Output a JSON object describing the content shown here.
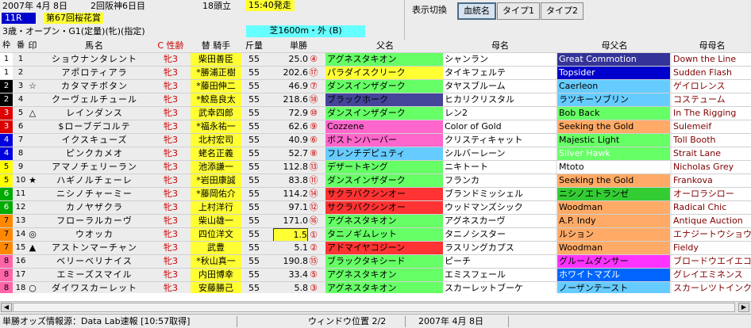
{
  "header": {
    "date": "2007年 4月 8日",
    "kaisai": "2回阪神6日目",
    "headcount": "18頭立",
    "start_time": "15:40発走",
    "race_no": "11R",
    "race_name": "第67回桜花賞",
    "conditions": "3歳・オープン・G1(定量)(牝)(指定)",
    "distance": "芝1600m・外 (B)",
    "display_label": "表示切換",
    "tabs": [
      "血統名",
      "タイプ1",
      "タイプ2"
    ]
  },
  "columns": {
    "frame": "枠",
    "num": "番",
    "mark": "印",
    "horse": "馬名",
    "sex": "C 性齢",
    "jockey": "替 騎手",
    "weight": "斤量",
    "odds": "単勝",
    "sire": "父名",
    "dam": "母名",
    "bms": "母父名",
    "mgs": "母母名"
  },
  "frame_colors": {
    "1": [
      "#ffffff",
      "#000000"
    ],
    "2": [
      "#000000",
      "#ffffff"
    ],
    "3": [
      "#dd0000",
      "#ffffff"
    ],
    "4": [
      "#0000dd",
      "#ffffff"
    ],
    "5": [
      "#ffff00",
      "#000000"
    ],
    "6": [
      "#00aa00",
      "#ffffff"
    ],
    "7": [
      "#ff8800",
      "#000000"
    ],
    "8": [
      "#ff66aa",
      "#000000"
    ]
  },
  "rows": [
    {
      "frame": "1",
      "num": "1",
      "mark": "",
      "horse": "ショウナンタレント",
      "sex": "牝3",
      "jockey": "柴田善臣",
      "weight": "55",
      "odds": "25.0",
      "pop": "④",
      "sire": "アグネスタキオン",
      "sire_bg": "#66ff66",
      "dam": "シャンラン",
      "bms": "Great Commotion",
      "bms_bg": "#333399",
      "bms_fg": "#ffffff",
      "mgs": "Down the Line"
    },
    {
      "frame": "1",
      "num": "2",
      "mark": "",
      "horse": "アポロティアラ",
      "sex": "牝3",
      "jockey": "*勝浦正樹",
      "weight": "55",
      "odds": "202.6",
      "pop": "⑰",
      "sire": "パラダイスクリーク",
      "sire_bg": "#ffff33",
      "dam": "タイキフェルテ",
      "bms": "Topsider",
      "bms_bg": "#0000cc",
      "bms_fg": "#ffffff",
      "mgs": "Sudden Flash"
    },
    {
      "frame": "2",
      "num": "3",
      "mark": "☆",
      "horse": "カタマチボタン",
      "sex": "牝3",
      "jockey": "*藤田伸二",
      "weight": "55",
      "odds": "46.9",
      "pop": "⑦",
      "sire": "ダンスインザダーク",
      "sire_bg": "#66ff66",
      "dam": "タヤスブルーム",
      "bms": "Caerleon",
      "bms_bg": "#66ccff",
      "bms_fg": "#000000",
      "mgs": "ゲイロレンス"
    },
    {
      "frame": "2",
      "num": "4",
      "mark": "",
      "horse": "クーヴェルチュール",
      "sex": "牝3",
      "jockey": "*鮫島良太",
      "weight": "55",
      "odds": "218.6",
      "pop": "⑱",
      "sire": "ブラックホーク",
      "sire_bg": "#444499",
      "dam": "ヒカリクリスタル",
      "bms": "ラツキーソブリン",
      "bms_bg": "#66ccff",
      "bms_fg": "#000000",
      "mgs": "コステューム"
    },
    {
      "frame": "3",
      "num": "5",
      "mark": "△",
      "horse": "レインダンス",
      "sex": "牝3",
      "jockey": "武幸四郎",
      "weight": "55",
      "odds": "72.9",
      "pop": "⑩",
      "sire": "ダンスインザダーク",
      "sire_bg": "#66ff66",
      "dam": "レン2",
      "bms": "Bob Back",
      "bms_bg": "#66ff66",
      "bms_fg": "#000000",
      "mgs": "In The Rigging"
    },
    {
      "frame": "3",
      "num": "6",
      "mark": "",
      "horse": "$ローブデコルテ",
      "sex": "牝3",
      "jockey": "*福永祐一",
      "weight": "55",
      "odds": "62.6",
      "pop": "⑨",
      "sire": "Cozzene",
      "sire_bg": "#ff66cc",
      "dam": "Color of Gold",
      "bms": "Seeking the Gold",
      "bms_bg": "#ffaa66",
      "bms_fg": "#000000",
      "mgs": "Sulemeif"
    },
    {
      "frame": "4",
      "num": "7",
      "mark": "",
      "horse": "イクスキューズ",
      "sex": "牝3",
      "jockey": "北村宏司",
      "weight": "55",
      "odds": "40.9",
      "pop": "⑥",
      "sire": "ボストンハーバー",
      "sire_bg": "#ff66cc",
      "dam": "クリスティキャット",
      "bms": "Majestic Light",
      "bms_bg": "#66ff66",
      "bms_fg": "#000000",
      "mgs": "Toll Booth"
    },
    {
      "frame": "4",
      "num": "8",
      "mark": "",
      "horse": "ピンクカメオ",
      "sex": "牝3",
      "jockey": "蛯名正義",
      "weight": "55",
      "odds": "52.7",
      "pop": "⑧",
      "sire": "フレンチデピュティ",
      "sire_bg": "#66ccff",
      "dam": "シルバーレーン",
      "bms": "Silver Hawk",
      "bms_bg": "#66ff66",
      "bms_fg": "#ffffff",
      "mgs": "Strait Lane"
    },
    {
      "frame": "5",
      "num": "9",
      "mark": "",
      "horse": "アマノチェリーラン",
      "sex": "牝3",
      "jockey": "池添謙一",
      "weight": "55",
      "odds": "112.8",
      "pop": "⑬",
      "sire": "デザートキング",
      "sire_bg": "#66ff66",
      "dam": "ニキトート",
      "bms": "Mtoto",
      "bms_bg": "#ffffff",
      "bms_fg": "#000000",
      "mgs": "Nicholas Grey"
    },
    {
      "frame": "5",
      "num": "10",
      "mark": "★",
      "horse": "ハギノルチェーレ",
      "sex": "牝3",
      "jockey": "*岩田康誠",
      "weight": "55",
      "odds": "83.8",
      "pop": "⑪",
      "sire": "ダンスインザダーク",
      "sire_bg": "#66ff66",
      "dam": "フランカ",
      "bms": "Seeking the Gold",
      "bms_bg": "#ffaa66",
      "bms_fg": "#000000",
      "mgs": "Frankova"
    },
    {
      "frame": "6",
      "num": "11",
      "mark": "",
      "horse": "ニシノチャーミー",
      "sex": "牝3",
      "jockey": "*藤岡佑介",
      "weight": "55",
      "odds": "114.2",
      "pop": "⑭",
      "sire": "サクラバクシンオー",
      "sire_bg": "#ff3333",
      "dam": "ブランドミッシェル",
      "bms": "ニシノエトランゼ",
      "bms_bg": "#33cc33",
      "bms_fg": "#000000",
      "mgs": "オーロラシロー"
    },
    {
      "frame": "6",
      "num": "12",
      "mark": "",
      "horse": "カノヤザクラ",
      "sex": "牝3",
      "jockey": "上村洋行",
      "weight": "55",
      "odds": "97.1",
      "pop": "⑫",
      "sire": "サクラバクシンオー",
      "sire_bg": "#ff3333",
      "dam": "ウッドマンズシック",
      "bms": "Woodman",
      "bms_bg": "#ffaa66",
      "bms_fg": "#000000",
      "mgs": "Radical Chic"
    },
    {
      "frame": "7",
      "num": "13",
      "mark": "",
      "horse": "フローラルカーヴ",
      "sex": "牝3",
      "jockey": "柴山雄一",
      "weight": "55",
      "odds": "171.0",
      "pop": "⑯",
      "sire": "アグネスタキオン",
      "sire_bg": "#66ff66",
      "dam": "アグネスカーヴ",
      "bms": "A.P. Indy",
      "bms_bg": "#ffaa66",
      "bms_fg": "#000000",
      "mgs": "Antique Auction"
    },
    {
      "frame": "7",
      "num": "14",
      "mark": "◎",
      "horse": "ウオッカ",
      "sex": "牝3",
      "jockey": "四位洋文",
      "weight": "55",
      "odds": "1.5",
      "pop": "①",
      "odds_hl": true,
      "sire": "タニノギムレット",
      "sire_bg": "#66ff66",
      "dam": "タニノシスター",
      "bms": "ルション",
      "bms_bg": "#ffaa66",
      "bms_fg": "#000000",
      "mgs": "エナジートウショウ"
    },
    {
      "frame": "7",
      "num": "15",
      "mark": "▲",
      "horse": "アストンマーチャン",
      "sex": "牝3",
      "jockey": "武豊",
      "weight": "55",
      "odds": "5.1",
      "pop": "②",
      "sire": "アドマイヤコジーン",
      "sire_bg": "#ff3333",
      "dam": "ラスリングカプス",
      "bms": "Woodman",
      "bms_bg": "#ffaa66",
      "bms_fg": "#000000",
      "mgs": "Fieldy"
    },
    {
      "frame": "8",
      "num": "16",
      "mark": "",
      "horse": "ベリーベリナイス",
      "sex": "牝3",
      "jockey": "*秋山真一",
      "weight": "55",
      "odds": "190.8",
      "pop": "⑮",
      "sire": "ブラックタキシード",
      "sire_bg": "#66ff66",
      "dam": "ピーチ",
      "bms": "グルームダンサー",
      "bms_bg": "#ff33ff",
      "bms_fg": "#000000",
      "mgs": "ブロードウエイエコル"
    },
    {
      "frame": "8",
      "num": "17",
      "mark": "",
      "horse": "エミーズスマイル",
      "sex": "牝3",
      "jockey": "内田博幸",
      "weight": "55",
      "odds": "33.4",
      "pop": "⑤",
      "sire": "アグネスタキオン",
      "sire_bg": "#66ff66",
      "dam": "エミスフェール",
      "bms": "ホワイトマズル",
      "bms_bg": "#0066ff",
      "bms_fg": "#ffffff",
      "mgs": "グレイエミネンス"
    },
    {
      "frame": "8",
      "num": "18",
      "mark": "○",
      "horse": "ダイワスカーレット",
      "sex": "牝3",
      "jockey": "安藤勝己",
      "weight": "55",
      "odds": "5.8",
      "pop": "③",
      "sire": "アグネスタキオン",
      "sire_bg": "#66ff66",
      "dam": "スカーレットブーケ",
      "bms": "ノーザンテースト",
      "bms_bg": "#66ccff",
      "bms_fg": "#000000",
      "mgs": "スカーレツトインク"
    }
  ],
  "status": {
    "source": "単勝オッズ情報源：Data Lab速報 [10:57取得]",
    "window_pos": "ウィンドウ位置 2/2",
    "date": "2007年 4月 8日"
  }
}
